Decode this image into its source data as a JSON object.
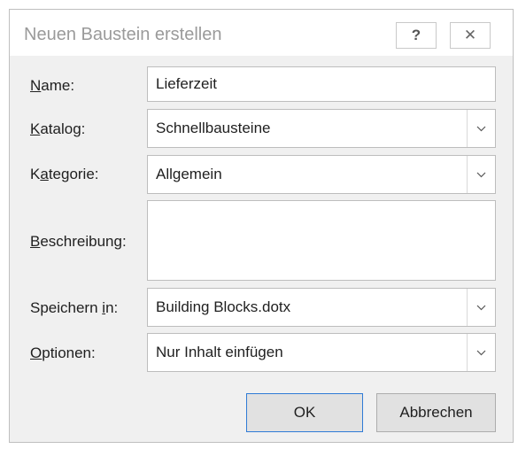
{
  "dialog": {
    "title": "Neuen Baustein erstellen",
    "help_glyph": "?",
    "close_glyph": "✕"
  },
  "fields": {
    "name": {
      "label_ul": "N",
      "label_rest": "ame:",
      "value": "Lieferzeit"
    },
    "katalog": {
      "label_ul": "K",
      "label_rest": "atalog:",
      "value": "Schnellbausteine"
    },
    "kategorie": {
      "label_pre": "K",
      "label_ul": "a",
      "label_rest": "tegorie:",
      "value": "Allgemein"
    },
    "beschreibung": {
      "label_ul": "B",
      "label_rest": "eschreibung:",
      "value": ""
    },
    "speichern": {
      "label_pre": "Speichern ",
      "label_ul": "i",
      "label_rest": "n:",
      "value": "Building Blocks.dotx"
    },
    "optionen": {
      "label_ul": "O",
      "label_rest": "ptionen:",
      "value": "Nur Inhalt einfügen"
    }
  },
  "buttons": {
    "ok": "OK",
    "cancel": "Abbrechen"
  },
  "icons": {
    "help": "help-icon",
    "close": "close-icon",
    "dropdown": "chevron-down-icon"
  }
}
